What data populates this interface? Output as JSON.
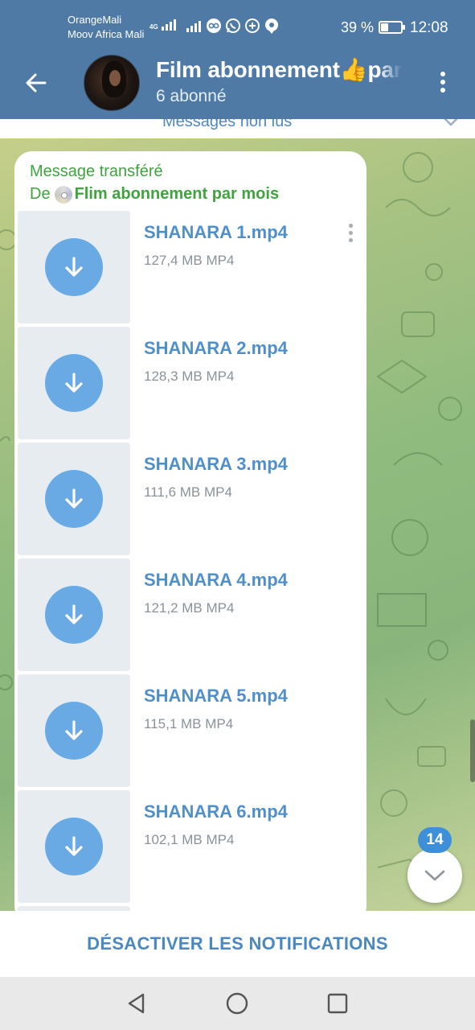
{
  "status_bar": {
    "carrier_1": "OrangeMali",
    "carrier_2": "Moov Africa Mali",
    "network_type": "4G",
    "battery_percent": "39 %",
    "battery_level": 0.39,
    "time": "12:08",
    "notification_icons": [
      "vpn-icon",
      "whatsapp-icon",
      "plus-circle-icon",
      "location-icon"
    ]
  },
  "header": {
    "back_icon": "arrow-left-icon",
    "title": "Film abonnement👍par mois",
    "subtitle": "6 abonné",
    "menu_icon": "more-vertical-icon"
  },
  "unread_banner": {
    "label": "Messages non lus",
    "icon": "chevron-down-icon"
  },
  "message": {
    "forwarded_label": "Message transféré",
    "from_prefix": "De",
    "from_name": "Flim abonnement par mois",
    "from_icon": "cd-disc-icon",
    "files": [
      {
        "name": "SHANARA 1.mp4",
        "meta": "127,4 MB MP4"
      },
      {
        "name": "SHANARA 2.mp4",
        "meta": "128,3 MB MP4"
      },
      {
        "name": "SHANARA 3.mp4",
        "meta": "111,6 MB MP4"
      },
      {
        "name": "SHANARA 4.mp4",
        "meta": "121,2 MB MP4"
      },
      {
        "name": "SHANARA 5.mp4",
        "meta": "115,1 MB MP4"
      },
      {
        "name": "SHANARA 6.mp4",
        "meta": "102,1 MB MP4"
      }
    ]
  },
  "scroll_down": {
    "unread_count": "14",
    "icon": "chevron-down-icon"
  },
  "bottom_bar": {
    "mute_label": "DÉSACTIVER LES NOTIFICATIONS"
  },
  "nav_bar": {
    "icons": [
      "back-triangle-icon",
      "home-circle-icon",
      "recents-square-icon"
    ]
  },
  "colors": {
    "header_bg": "#4f7aa6",
    "accent_blue": "#4f90cc",
    "download_button": "#6aaae4",
    "forward_green": "#3fa33f",
    "badge_blue": "#3d8fd9"
  }
}
